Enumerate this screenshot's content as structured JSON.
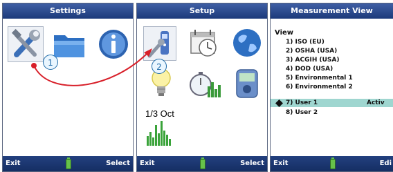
{
  "screens": {
    "settings": {
      "title": "Settings",
      "left": "Exit",
      "right": "Select"
    },
    "setup": {
      "title": "Setup",
      "left": "Exit",
      "right": "Select"
    },
    "measurement": {
      "title": "Measurement View",
      "left": "Exit",
      "right": "Edi"
    }
  },
  "callouts": {
    "one": "1",
    "two": "2"
  },
  "setup_trend": {
    "label": "1/3 Oct"
  },
  "measurement_view": {
    "section": "View",
    "items": [
      {
        "label": "1) ISO (EU)"
      },
      {
        "label": "2) OSHA (USA)"
      },
      {
        "label": "3) ACGIH (USA)"
      },
      {
        "label": "4) DOD (USA)"
      },
      {
        "label": "5) Environmental 1"
      },
      {
        "label": "6) Environmental 2"
      },
      {
        "label": "7) User 1",
        "status": "Activ",
        "selected": true
      },
      {
        "label": "8) User 2"
      }
    ]
  },
  "colors": {
    "titlebar": "#1c3a7a",
    "accent_arrow": "#d8202a",
    "selection": "#9fd6d0"
  }
}
